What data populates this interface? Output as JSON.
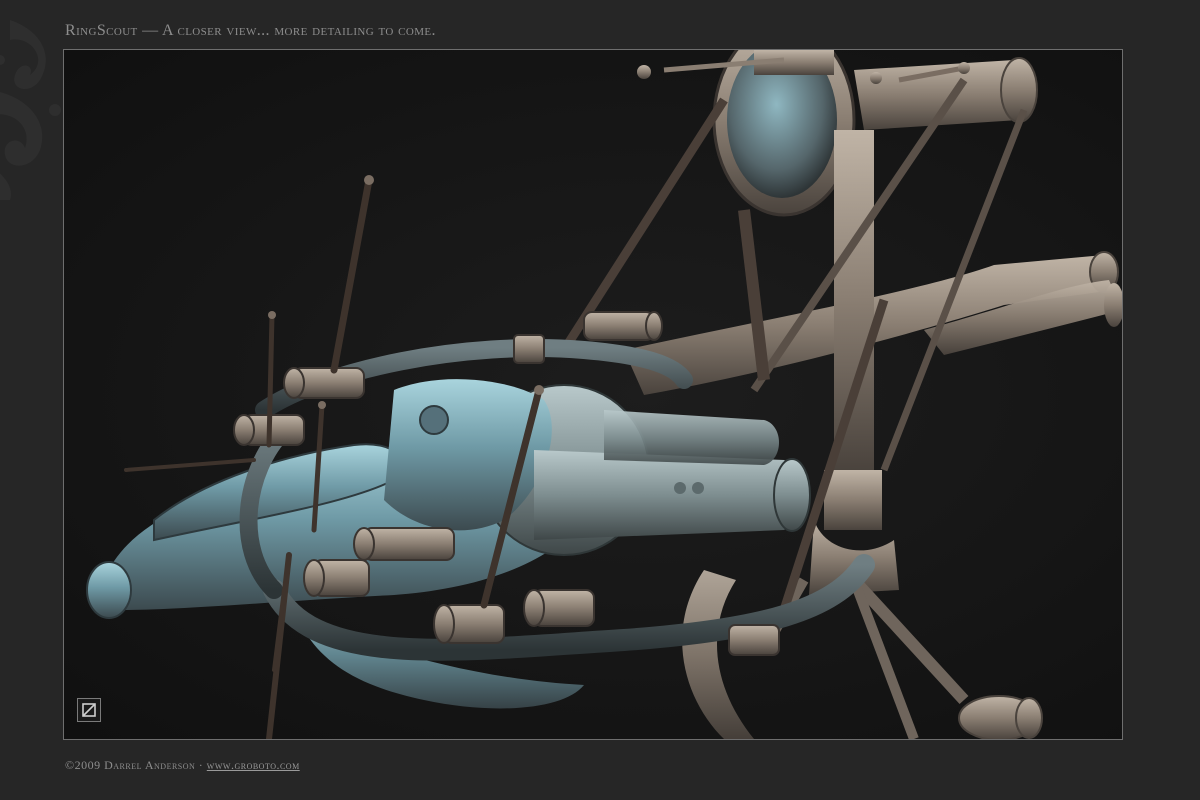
{
  "header": {
    "title": "RingScout — A closer view... more detailing to come."
  },
  "footer": {
    "copyright": "©2009 Darrel Anderson ·",
    "link_text": "www.groboto.com"
  },
  "image": {
    "subject_icon": "spaceship-render-icon",
    "badge_icon": "groboto-logo-icon"
  },
  "colors": {
    "background": "#262626",
    "frame_border": "#6e6e6e",
    "text": "#8d8d8d",
    "metal_light": "#9fc4cc",
    "metal_mid": "#7d8a8c",
    "metal_warm": "#9a8876"
  }
}
